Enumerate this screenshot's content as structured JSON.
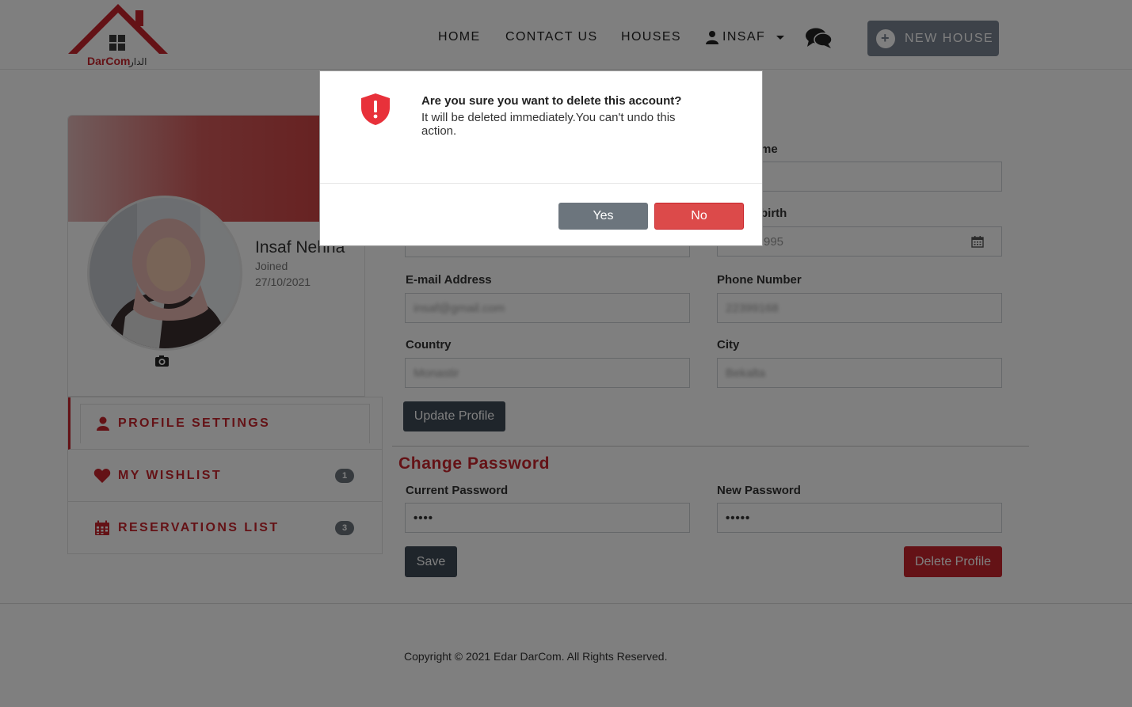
{
  "navbar": {
    "logo_text": "DarCom",
    "logo_arabic": "الدار",
    "links": {
      "home": "HOME",
      "contact": "CONTACT US",
      "houses": "HOUSES",
      "user": "INSAF"
    },
    "new_house_label": "NEW HOUSE"
  },
  "profile": {
    "name": "Insaf Nehha",
    "joined_label": "Joined",
    "joined_date": "27/10/2021"
  },
  "menu": {
    "items": [
      {
        "label": "PROFILE SETTINGS",
        "badge": ""
      },
      {
        "label": "MY WISHLIST",
        "badge": "1"
      },
      {
        "label": "RESERVATIONS LIST",
        "badge": "3"
      }
    ]
  },
  "form": {
    "name_label_partial": "me",
    "dob_label_partial": "birth",
    "dob_value_partial": "995",
    "email_label": "E-mail Address",
    "email_value": "insaf@gmail.com",
    "phone_label": "Phone Number",
    "phone_value": "22399168",
    "country_label": "Country",
    "country_value": "Monastir",
    "city_label": "City",
    "city_value": "Bekalta",
    "update_button": "Update Profile"
  },
  "password": {
    "title": "Change Password",
    "current_label": "Current Password",
    "current_value": "••••",
    "new_label": "New Password",
    "new_value": "•••••",
    "save_button": "Save",
    "delete_button": "Delete Profile"
  },
  "footer": {
    "copyright": "Copyright © 2021 Edar DarCom. All Rights Reserved."
  },
  "modal": {
    "title": "Are you sure you want to delete this account?",
    "message": "It will be deleted immediately.You can't undo this action.",
    "yes_label": "Yes",
    "no_label": "No"
  },
  "colors": {
    "brand_red": "#c9252c",
    "dark_button": "#3f4a56",
    "gray_button": "#6c757d",
    "no_button": "#dc4a4a"
  }
}
